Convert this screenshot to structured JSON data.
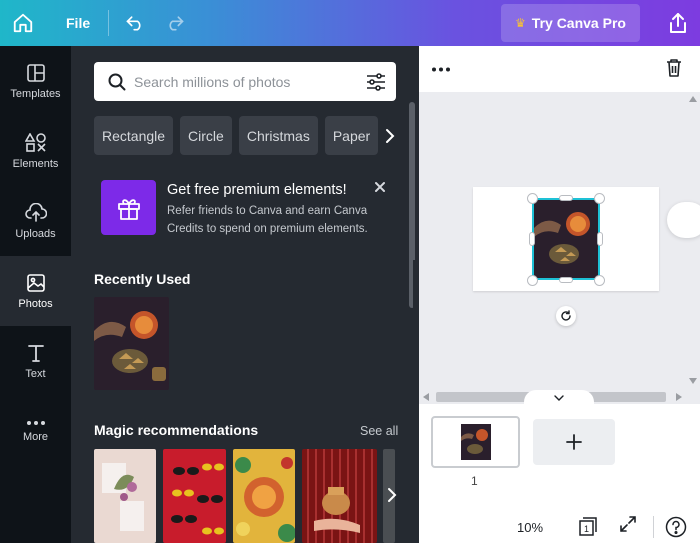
{
  "topbar": {
    "file_label": "File",
    "pro_label": "Try Canva Pro"
  },
  "rail": [
    {
      "label": "Templates",
      "icon": "templates-icon"
    },
    {
      "label": "Elements",
      "icon": "elements-icon"
    },
    {
      "label": "Uploads",
      "icon": "uploads-icon"
    },
    {
      "label": "Photos",
      "icon": "photos-icon",
      "active": true
    },
    {
      "label": "Text",
      "icon": "text-icon"
    },
    {
      "label": "More",
      "icon": "more-icon"
    }
  ],
  "search": {
    "placeholder": "Search millions of photos"
  },
  "chips": [
    "Rectangle",
    "Circle",
    "Christmas",
    "Paper"
  ],
  "promo": {
    "title": "Get free premium elements!",
    "text": "Refer friends to Canva and earn Canva Credits to spend on premium elements."
  },
  "recent": {
    "title": "Recently Used"
  },
  "magic": {
    "title": "Magic recommendations",
    "see_all": "See all"
  },
  "canvas": {
    "page_number": "1",
    "zoom": "10%"
  },
  "colors": {
    "accent": "#7d2ae8",
    "selection": "#1ec1d6",
    "panel": "#252a31",
    "rail": "#0e1318"
  }
}
